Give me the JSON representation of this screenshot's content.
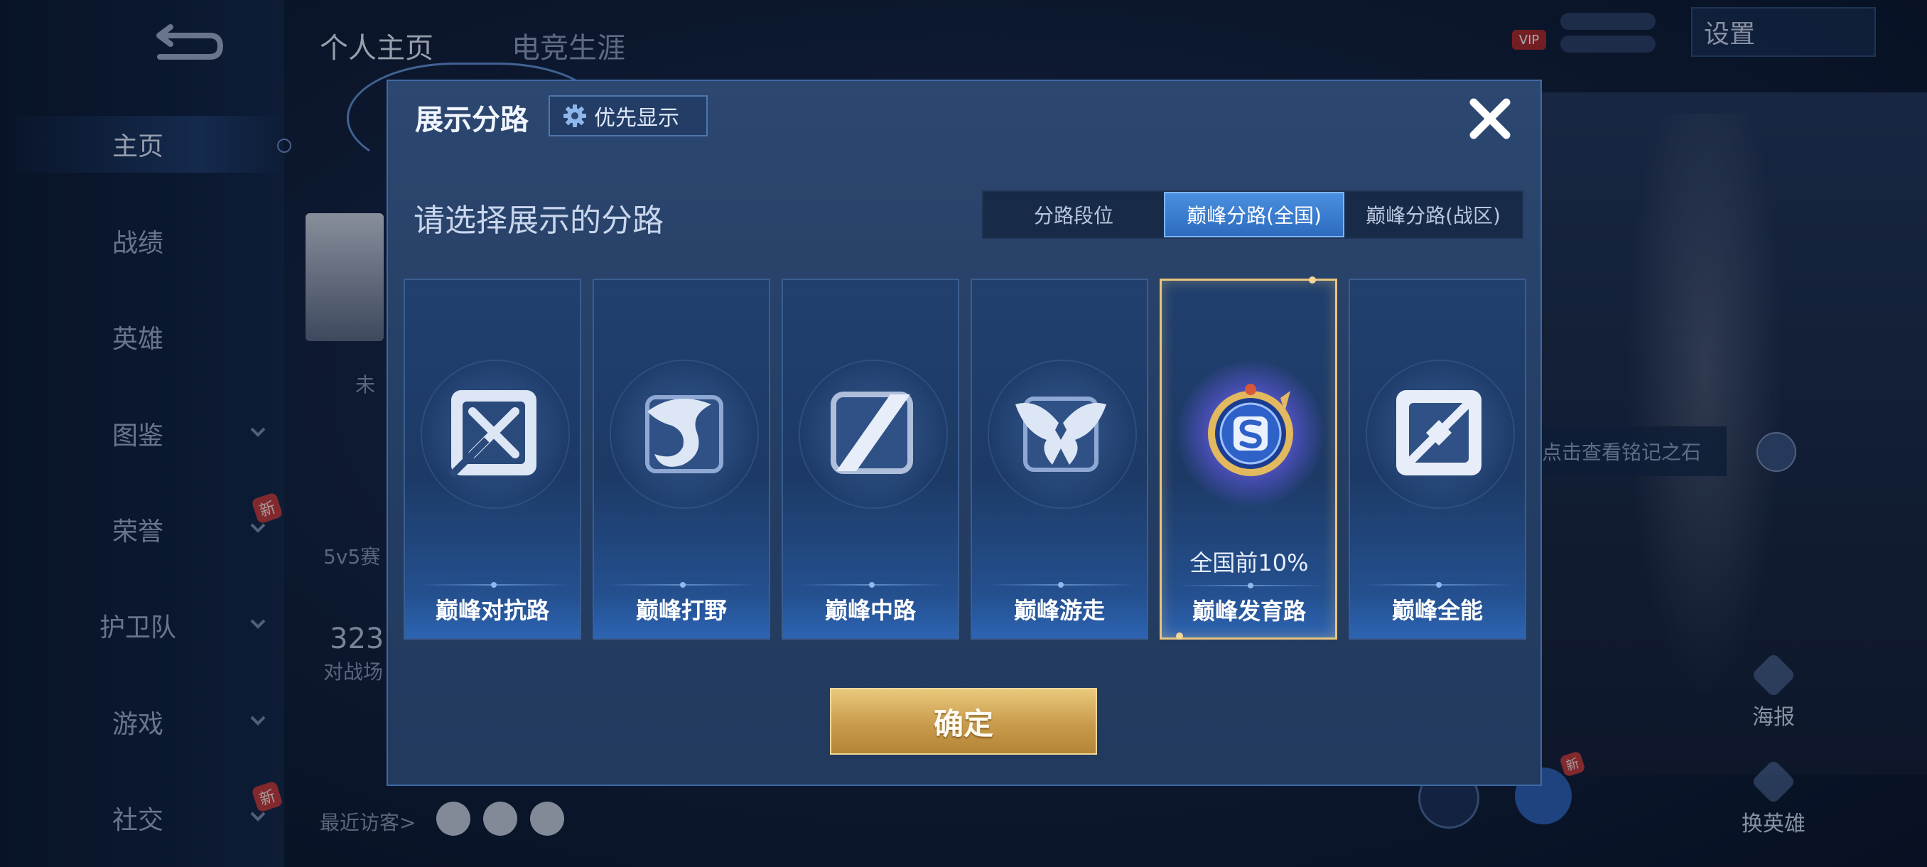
{
  "background": {
    "nav": {
      "items": [
        {
          "label": "主页",
          "active": true,
          "chevron": false,
          "badge": ""
        },
        {
          "label": "战绩",
          "active": false,
          "chevron": false,
          "badge": ""
        },
        {
          "label": "英雄",
          "active": false,
          "chevron": false,
          "badge": ""
        },
        {
          "label": "图鉴",
          "active": false,
          "chevron": true,
          "badge": ""
        },
        {
          "label": "荣誉",
          "active": false,
          "chevron": true,
          "badge": "新"
        },
        {
          "label": "护卫队",
          "active": false,
          "chevron": true,
          "badge": ""
        },
        {
          "label": "游戏",
          "active": false,
          "chevron": true,
          "badge": ""
        },
        {
          "label": "社交",
          "active": false,
          "chevron": true,
          "badge": "新"
        }
      ]
    },
    "tabs": [
      "个人主页",
      "电竞生涯"
    ],
    "settings_label": "设置",
    "vip_label": "VIP",
    "profile_texts": {
      "status": "未",
      "mode": "5v5赛",
      "count": "323",
      "count_label": "对战场",
      "recent_visitors": "最近访客>"
    },
    "inscription_hint": "点击查看铭记之石",
    "actions": {
      "poster": "海报",
      "change_hero": "换英雄",
      "new_badge": "新"
    }
  },
  "dialog": {
    "title": "展示分路",
    "priority_label": "优先显示",
    "subtitle": "请选择展示的分路",
    "segments": [
      "分路段位",
      "巅峰分路(全国)",
      "巅峰分路(战区)"
    ],
    "active_segment": 1,
    "cards": [
      {
        "name": "巅峰对抗路",
        "icon": "clash-lane-icon",
        "rank": "",
        "selected": false
      },
      {
        "name": "巅峰打野",
        "icon": "jungle-icon",
        "rank": "",
        "selected": false
      },
      {
        "name": "巅峰中路",
        "icon": "mid-lane-icon",
        "rank": "",
        "selected": false
      },
      {
        "name": "巅峰游走",
        "icon": "roam-icon",
        "rank": "",
        "selected": false
      },
      {
        "name": "巅峰发育路",
        "icon": "farm-lane-emblem-icon",
        "rank": "全国前10%",
        "selected": true
      },
      {
        "name": "巅峰全能",
        "icon": "all-round-icon",
        "rank": "",
        "selected": false
      }
    ],
    "confirm_label": "确定"
  },
  "colors": {
    "accent_blue": "#4a8fe0",
    "gold": "#e8c57e",
    "dialog_bg": "#2c4770"
  }
}
